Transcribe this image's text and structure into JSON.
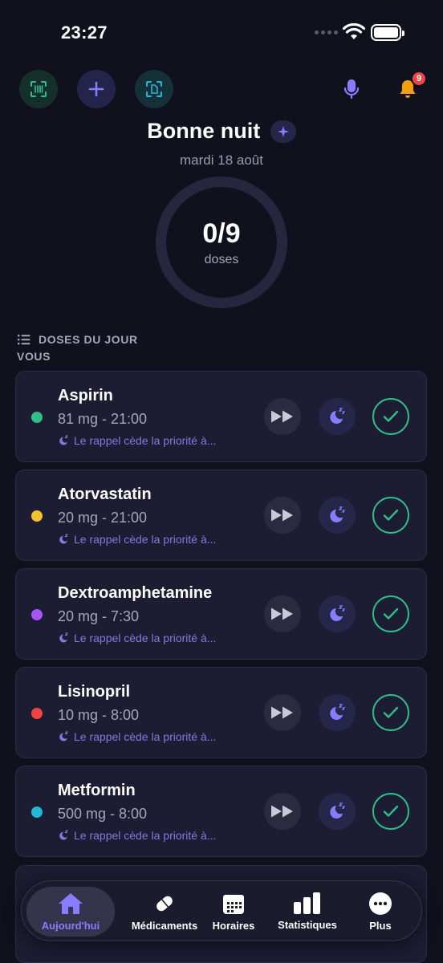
{
  "status_bar": {
    "time": "23:27"
  },
  "header": {
    "notification_count": "9",
    "greeting": "Bonne nuit",
    "date": "mardi 18 août"
  },
  "progress": {
    "taken": 0,
    "total": 9,
    "count_text": "0/9",
    "label": "doses"
  },
  "section": {
    "title": "DOSES DU JOUR",
    "subtitle": "VOUS"
  },
  "doses": [
    {
      "name": "Aspirin",
      "dose": "81 mg - 21:00",
      "note": "Le rappel cède la priorité à...",
      "color": "#2fbf86"
    },
    {
      "name": "Atorvastatin",
      "dose": "20 mg - 21:00",
      "note": "Le rappel cède la priorité à...",
      "color": "#f5c02e"
    },
    {
      "name": "Dextroamphetamine",
      "dose": "20 mg - 7:30",
      "note": "Le rappel cède la priorité à...",
      "color": "#a855f7"
    },
    {
      "name": "Lisinopril",
      "dose": "10 mg - 8:00",
      "note": "Le rappel cède la priorité à...",
      "color": "#ef4444"
    },
    {
      "name": "Metformin",
      "dose": "500 mg - 8:00",
      "note": "Le rappel cède la priorité à...",
      "color": "#22b8d8"
    }
  ],
  "nav": {
    "items": [
      {
        "label": "Aujourd'hui",
        "icon": "home-icon"
      },
      {
        "label": "Médicaments",
        "icon": "pill-icon"
      },
      {
        "label": "Horaires",
        "icon": "calendar-icon"
      },
      {
        "label": "Statistiques",
        "icon": "bar-chart-icon"
      },
      {
        "label": "Plus",
        "icon": "more-icon"
      }
    ]
  },
  "colors": {
    "accent": "#8b7cff",
    "success": "#2fbf86",
    "background": "#11111d",
    "card": "#1c1c32",
    "alert": "#ef4444",
    "bell": "#f59e0b"
  }
}
